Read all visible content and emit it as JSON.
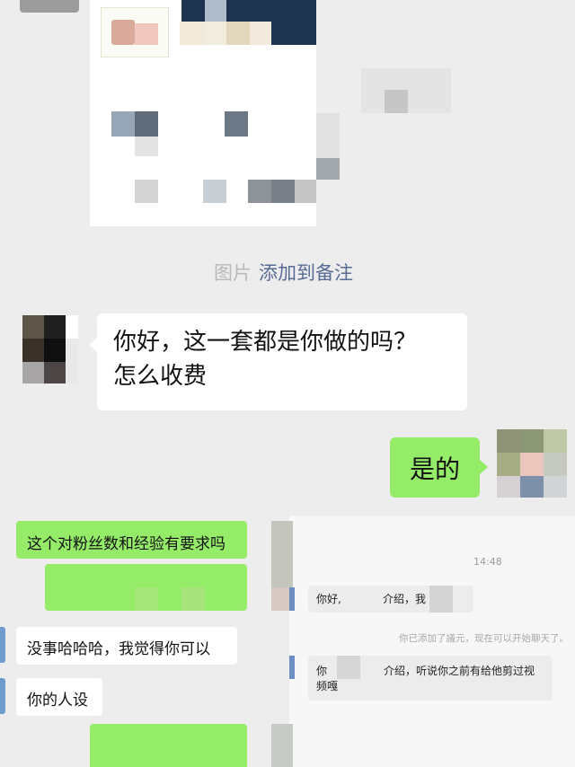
{
  "system_note": {
    "photo_suffix": "图片",
    "add_to_remark": "添加到备注"
  },
  "messages": {
    "incoming_1_line1": "你好，这一套都是你做的吗？",
    "incoming_1_line2": "怎么收费",
    "outgoing_1": "是的"
  },
  "screenshot_left": {
    "green_1": "这个对粉丝数和经验有要求吗",
    "white_1": "没事哈哈哈，我觉得你可以",
    "white_2": "你的人设"
  },
  "screenshot_right": {
    "time": "14:48",
    "msg_1_prefix": "你好,",
    "msg_1_suffix": "介绍，我",
    "system": "你已添加了議元，现在可以开始聊天了。",
    "msg_2_prefix": "你",
    "msg_2_suffix": "介绍，听说你之前有给他剪过视",
    "msg_2_line2": "频嘎"
  },
  "colors": {
    "background": "#ededed",
    "green_bubble": "#95ec69",
    "link": "#576b95"
  }
}
